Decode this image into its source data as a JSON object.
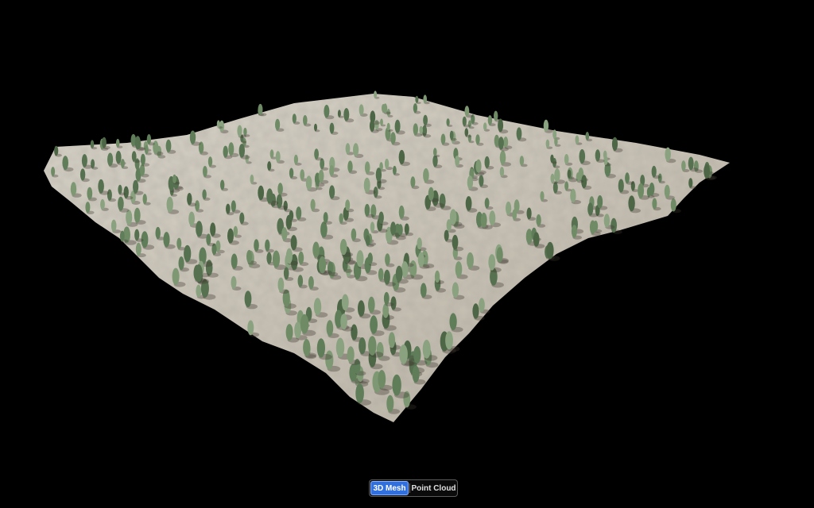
{
  "viewer": {
    "background_color": "#000000",
    "terrain_ground_color": "#cfc9bd",
    "terrain_tree_color": "#6f8b66"
  },
  "view_toggle": {
    "mesh_label": "3D Mesh",
    "pointcloud_label": "Point Cloud",
    "selected": "3D Mesh",
    "active_color": "#2f6fde"
  }
}
